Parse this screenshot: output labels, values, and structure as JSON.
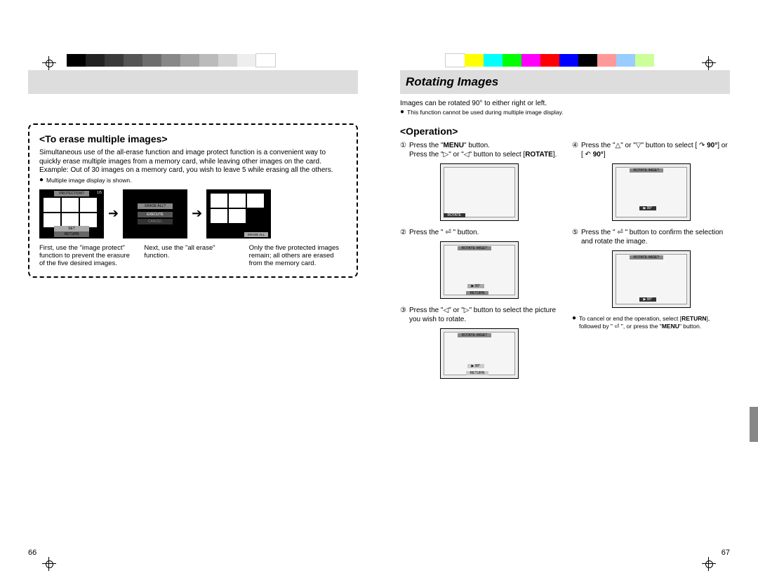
{
  "colorbar_gray": [
    "#000",
    "#222",
    "#3a3a3a",
    "#555",
    "#6e6e6e",
    "#888",
    "#a2a2a2",
    "#bbb",
    "#d4d4d4",
    "#eee",
    "#fff"
  ],
  "colorbar_color": [
    "#fff",
    "#ff0",
    "#0ff",
    "#0f0",
    "#f0f",
    "#f00",
    "#00f",
    "#000",
    "#f99",
    "#9cf",
    "#cf9"
  ],
  "left": {
    "box_title": "<To erase multiple images>",
    "body": "Simultaneous use of the all-erase function and image protect function is a convenient way to quickly erase multiple images from a memory card, while leaving other images on the card.\nExample: Out of 30 images on a memory card, you wish to leave 5 while erasing all the others.",
    "bullet": "Multiple image display is shown.",
    "lcd1_top": "PROTECTION?",
    "lcd1_count": "1/5",
    "lcd1_set": "SET",
    "lcd1_return": "RETURN",
    "lcd2_top": "ERASE ALL?",
    "lcd2_exec": "EXECUTE",
    "lcd2_cancel": "CANCEL",
    "lcd3_erase": "ERASE ALL",
    "cap1": "First, use the \"image protect\" function to prevent the erasure of the five desired images.",
    "cap2": "Next, use the \"all erase\" function.",
    "cap3": "Only the five protected images remain; all others are erased from the memory card.",
    "pagenum": "66"
  },
  "right": {
    "title": "Rotating Images",
    "intro": "Images can be rotated 90° to either right or left.",
    "bullet_intro": "This function cannot be used during multiple image display.",
    "op_heading": "<Operation>",
    "step1a": "Press the \"",
    "step1b": "MENU",
    "step1c": "\" button.",
    "step1d": "Press the \"▷\" or \"◁\" button to select [",
    "step1e": "ROTATE",
    "step1f": "].",
    "step2": "Press the \" ⏎ \" button.",
    "step3": "Press the \"◁\" or \"▷\" button to select the picture you wish to rotate.",
    "step4a": "Press the \"△\" or \"▽\" button to select [ ↷ ",
    "step4b": "90°",
    "step4c": "] or [ ↶ ",
    "step4d": "90°",
    "step4e": "]",
    "step5": "Press the \" ⏎ \" button to confirm the selection and rotate the image.",
    "note1": "To cancel or end the operation, select [",
    "note2": "RETURN",
    "note3": "], followed by \" ⏎ \", or press the \"",
    "note4": "MENU",
    "note5": "\" button.",
    "mini_label": "ROTATE IMGE?",
    "mini_90": "▶ 90°",
    "mini_return": "RETURN",
    "mini_rotate_tab": "ROTATE",
    "pagenum": "67"
  },
  "circled": [
    "①",
    "②",
    "③",
    "④",
    "⑤"
  ]
}
